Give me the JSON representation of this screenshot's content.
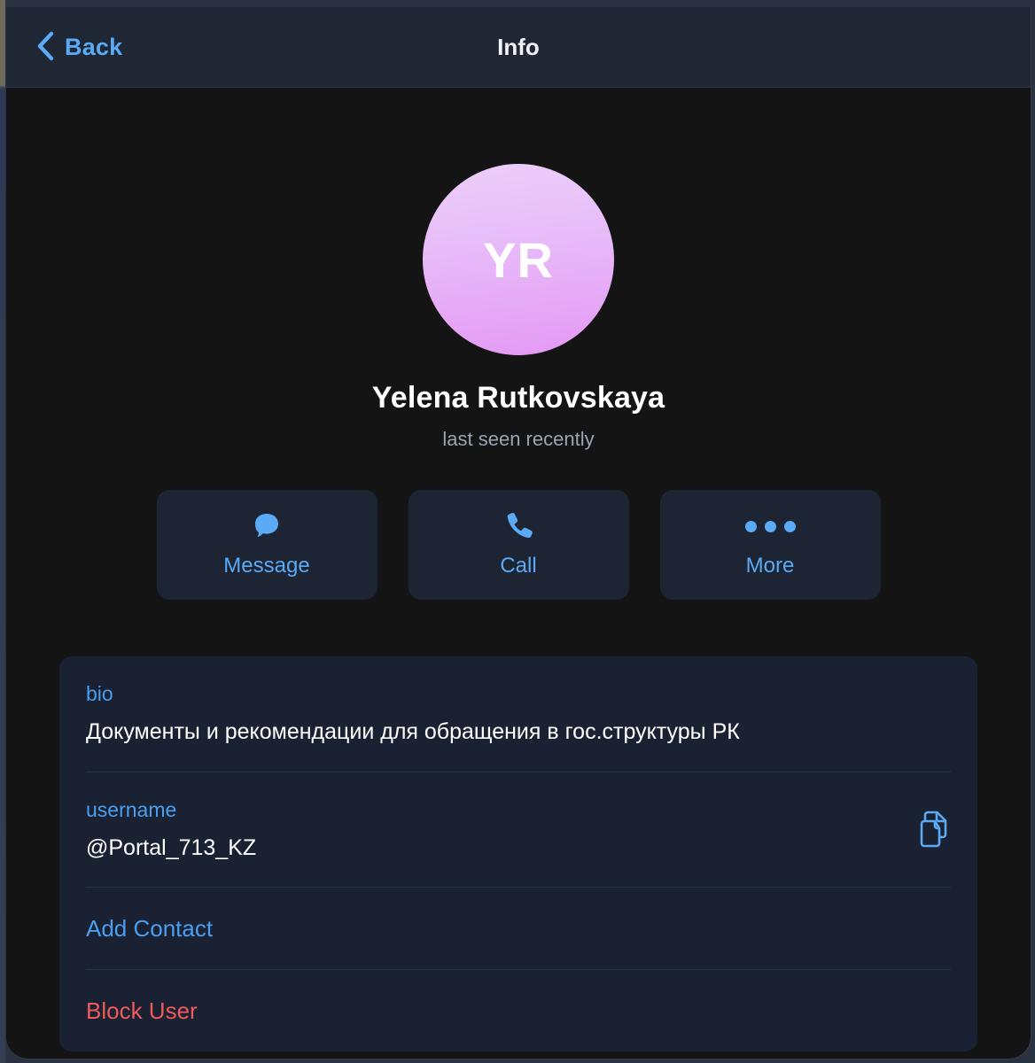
{
  "window": {
    "navbar": {
      "back_label": "Back",
      "back_icon": "chevron-left-icon",
      "title": "Info"
    }
  },
  "profile": {
    "avatar_initials": "YR",
    "avatar_gradient_from": "#edcefb",
    "avatar_gradient_to": "#e497f4",
    "name": "Yelena Rutkovskaya",
    "status": "last seen recently"
  },
  "actions": [
    {
      "label": "Message",
      "icon": "chat-bubble-icon"
    },
    {
      "label": "Call",
      "icon": "phone-icon"
    },
    {
      "label": "More",
      "icon": "ellipsis-icon"
    }
  ],
  "info_card": {
    "bio": {
      "label": "bio",
      "value": "Документы и рекомендации для обращения в гос.структуры РК"
    },
    "username": {
      "label": "username",
      "value": "@Portal_713_KZ",
      "copy_icon": "copy-icon"
    },
    "add_contact_label": "Add Contact",
    "block_user_label": "Block User"
  },
  "colors": {
    "accent_blue": "#5aaaf5",
    "danger_red": "#ef5a5a",
    "navbar_bg": "#1f2634",
    "card_bg": "#1a2132",
    "page_bg": "#141414"
  }
}
